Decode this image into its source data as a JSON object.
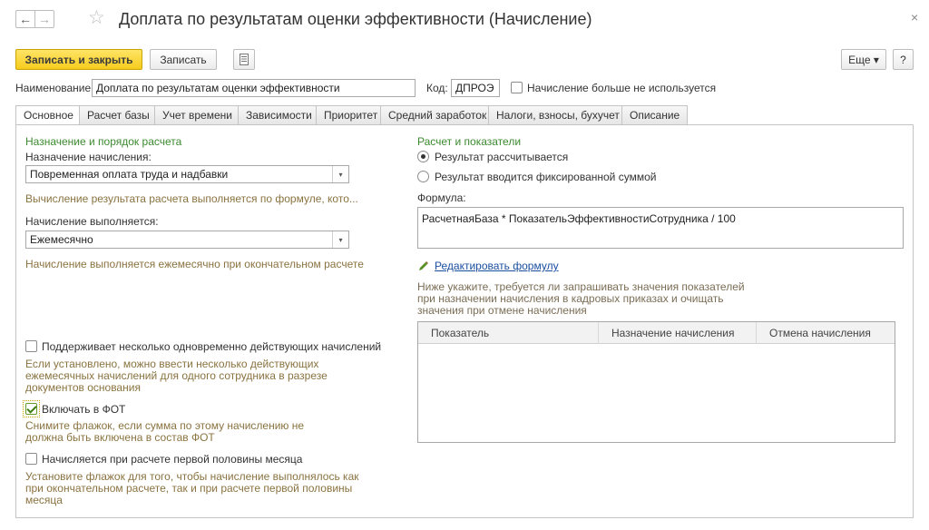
{
  "window": {
    "title": "Доплата по результатам оценки эффективности (Начисление)",
    "back_glyph": "←",
    "forward_glyph": "→",
    "star_glyph": "☆",
    "close_glyph": "×"
  },
  "toolbar": {
    "save_close_label": "Записать и закрыть",
    "save_label": "Записать",
    "more_label": "Еще ▾",
    "help_label": "?"
  },
  "name_row": {
    "name_label": "Наименование:",
    "name_value": "Доплата по результатам оценки эффективности",
    "code_label": "Код:",
    "code_value": "ДПРОЭ",
    "not_used_label": "Начисление больше не используется"
  },
  "tabs": [
    {
      "label": "Основное",
      "active": true
    },
    {
      "label": "Расчет базы",
      "active": false
    },
    {
      "label": "Учет времени",
      "active": false
    },
    {
      "label": "Зависимости",
      "active": false
    },
    {
      "label": "Приоритет",
      "active": false
    },
    {
      "label": "Средний заработок",
      "active": false
    },
    {
      "label": "Налоги, взносы, бухучет",
      "active": false
    },
    {
      "label": "Описание",
      "active": false
    }
  ],
  "left": {
    "section_title": "Назначение и порядок расчета",
    "purpose_label": "Назначение начисления:",
    "purpose_value": "Повременная оплата труда и надбавки",
    "purpose_hint": "Вычисление результата расчета выполняется по формуле, кото...",
    "frequency_label": "Начисление выполняется:",
    "frequency_value": "Ежемесячно",
    "frequency_hint": "Начисление выполняется ежемесячно при окончательном расчете",
    "multi_label": "Поддерживает несколько одновременно действующих начислений",
    "multi_hint_1": "Если установлено, можно ввести несколько действующих",
    "multi_hint_2": "ежемесячных начислений для одного сотрудника в разрезе",
    "multi_hint_3": "документов основания",
    "fot_label": "Включать в ФОТ",
    "fot_hint_1": "Снимите флажок, если сумма по этому начислению не",
    "fot_hint_2": "должна быть включена в состав ФОТ",
    "half_label": "Начисляется при расчете первой половины месяца",
    "half_hint_1": "Установите флажок для того, чтобы начисление выполнялось как",
    "half_hint_2": "при окончательном расчете, так и при расчете первой половины",
    "half_hint_3": "месяца"
  },
  "right": {
    "section_title": "Расчет и показатели",
    "radio_calc_label": "Результат рассчитывается",
    "radio_fixed_label": "Результат вводится фиксированной суммой",
    "formula_label": "Формула:",
    "formula_value": "РасчетнаяБаза * ПоказательЭффективностиСотрудника / 100",
    "edit_formula_link": "Редактировать формулу",
    "indicators_hint_1": "Ниже укажите, требуется ли запрашивать значения показателей",
    "indicators_hint_2": "при назначении начисления в кадровых приказах и очищать",
    "indicators_hint_3": "значения при отмене начисления",
    "table_headers": [
      "Показатель",
      "Назначение начисления",
      "Отмена начисления"
    ]
  }
}
